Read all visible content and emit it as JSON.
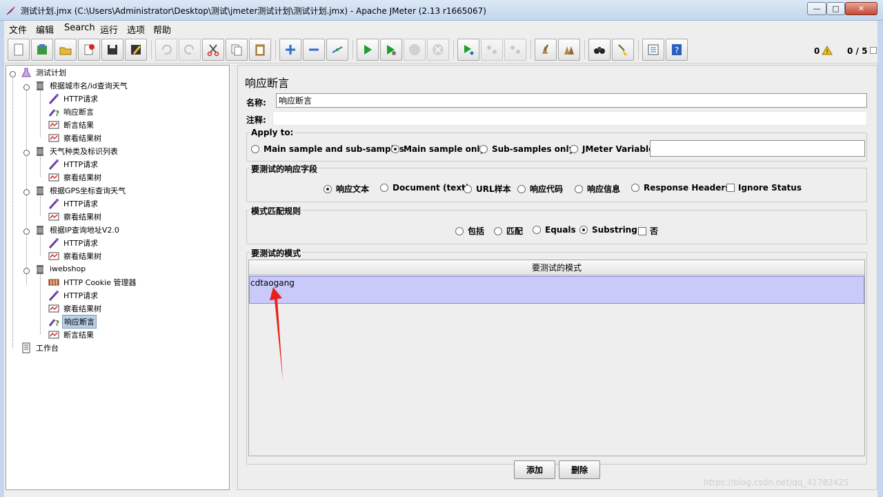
{
  "window": {
    "title": "测试计划.jmx (C:\\Users\\Administrator\\Desktop\\测试\\jmeter测试计划\\测试计划.jmx) - Apache JMeter (2.13 r1665067)",
    "min_symbol": "—",
    "max_symbol": "□",
    "close_symbol": "✕"
  },
  "menu": [
    "文件",
    "编辑",
    "Search",
    "运行",
    "选项",
    "帮助"
  ],
  "toolbar": {
    "buttons": [
      "new-icon",
      "templates-icon",
      "open-icon",
      "close-icon",
      "save-icon",
      "save-as-icon",
      "undo-icon",
      "redo-icon",
      "cut-icon",
      "copy-icon",
      "paste-icon",
      "expand-icon",
      "collapse-icon",
      "toggle-icon",
      "start-icon",
      "start-no-pause-icon",
      "stop-icon",
      "shutdown-icon",
      "remote-start-icon",
      "remote-stop-icon",
      "remote-shutdown-icon",
      "clear-icon",
      "clear-all-icon",
      "search-icon",
      "reset-search-icon",
      "function-helper-icon",
      "help-icon"
    ],
    "error_count": "0",
    "threads": "0 / 5"
  },
  "tree": {
    "items": [
      {
        "label": "测试计划",
        "icon": "test-plan-icon",
        "level": 0
      },
      {
        "label": "根据城市名/id查询天气",
        "icon": "thread-group-icon",
        "level": 1
      },
      {
        "label": "HTTP请求",
        "icon": "http-sampler-icon",
        "level": 2
      },
      {
        "label": "响应断言",
        "icon": "assertion-icon",
        "level": 2
      },
      {
        "label": "断言结果",
        "icon": "listener-icon",
        "level": 2
      },
      {
        "label": "察看结果树",
        "icon": "listener-icon",
        "level": 2
      },
      {
        "label": "天气种类及标识列表",
        "icon": "thread-group-icon",
        "level": 1
      },
      {
        "label": "HTTP请求",
        "icon": "http-sampler-icon",
        "level": 2
      },
      {
        "label": "察看结果树",
        "icon": "listener-icon",
        "level": 2
      },
      {
        "label": "根据GPS坐标查询天气",
        "icon": "thread-group-icon",
        "level": 1
      },
      {
        "label": "HTTP请求",
        "icon": "http-sampler-icon",
        "level": 2
      },
      {
        "label": "察看结果树",
        "icon": "listener-icon",
        "level": 2
      },
      {
        "label": "根据IP查询地址V2.0",
        "icon": "thread-group-icon",
        "level": 1
      },
      {
        "label": "HTTP请求",
        "icon": "http-sampler-icon",
        "level": 2
      },
      {
        "label": "察看结果树",
        "icon": "listener-icon",
        "level": 2
      },
      {
        "label": "iwebshop",
        "icon": "thread-group-icon",
        "level": 1
      },
      {
        "label": "HTTP Cookie 管理器",
        "icon": "cookie-manager-icon",
        "level": 2
      },
      {
        "label": "HTTP请求",
        "icon": "http-sampler-icon",
        "level": 2
      },
      {
        "label": "察看结果树",
        "icon": "listener-icon",
        "level": 2
      },
      {
        "label": "响应断言",
        "icon": "assertion-icon",
        "level": 2,
        "selected": true
      },
      {
        "label": "断言结果",
        "icon": "listener-icon",
        "level": 2
      },
      {
        "label": "工作台",
        "icon": "workbench-icon",
        "level": 0
      }
    ]
  },
  "panel": {
    "title": "响应断言",
    "name_label": "名称:",
    "name_value": "响应断言",
    "comment_label": "注释:",
    "comment_value": "",
    "apply_to": {
      "title": "Apply to:",
      "options": [
        "Main sample and sub-samples",
        "Main sample only",
        "Sub-samples only",
        "JMeter Variable"
      ],
      "selected": "Main sample only",
      "variable_value": ""
    },
    "field": {
      "title": "要测试的响应字段",
      "options": [
        "响应文本",
        "Document (text)",
        "URL样本",
        "响应代码",
        "响应信息",
        "Response Headers"
      ],
      "selected": "响应文本",
      "ignore_status_label": "Ignore Status",
      "ignore_status": false
    },
    "rules": {
      "title": "模式匹配规则",
      "options": [
        "包括",
        "匹配",
        "Equals",
        "Substring"
      ],
      "selected": "Substring",
      "not_label": "否",
      "not_checked": false
    },
    "patterns": {
      "title": "要测试的模式",
      "column_header": "要测试的模式",
      "rows": [
        "cdtaogang"
      ]
    },
    "add_button": "添加",
    "delete_button": "删除"
  },
  "annotation": {
    "color": "#e8211b"
  },
  "watermark": "https://blog.csdn.net/qq_41782425"
}
